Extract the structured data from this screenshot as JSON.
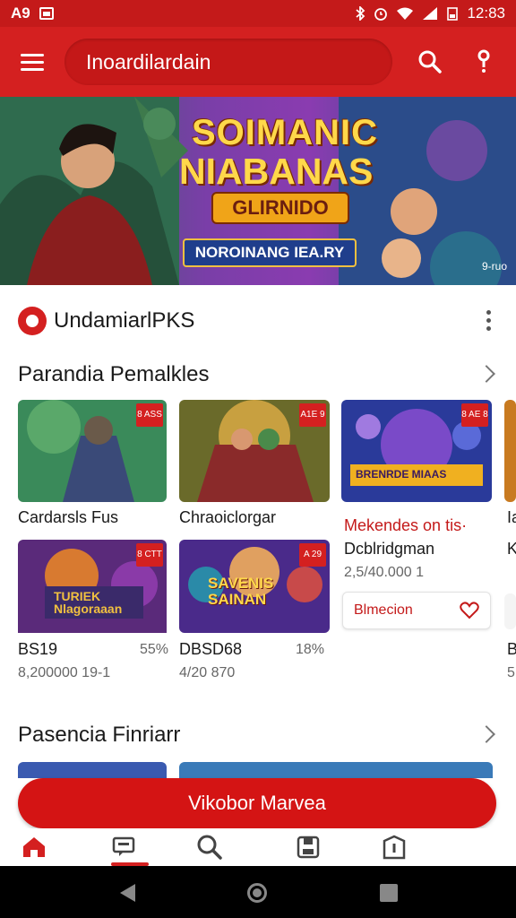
{
  "status": {
    "carrier": "A9",
    "time": "12:83"
  },
  "header": {
    "title": "Inoardilardain"
  },
  "banner": {
    "title_line1": "SOIMANIC",
    "title_line2": "NIABANAS",
    "title_line3": "GLIRNIDO",
    "subtitle": "NOROINANG IEA.RY",
    "corner": "9-ruo"
  },
  "brand": {
    "name": "UndamiarlPKS"
  },
  "sections": [
    {
      "title": "Parandia Pemalkles"
    },
    {
      "title": "Pasencia Finriarr"
    }
  ],
  "cards": [
    {
      "badge": "8 ASS",
      "title": "Cardarsls Fus"
    },
    {
      "badge": "A1E 9",
      "title": "Chraoiclorgar"
    },
    {
      "badge": "8 AE 8",
      "title": "BRENRDE MIAAS"
    },
    {
      "badge": "8 CTT",
      "price": "BS19",
      "discount": "55%",
      "sub": "8,200000 19-1",
      "label": "TURIEK Nlagoraaan"
    },
    {
      "badge": "A 29",
      "price": "DBSD68",
      "discount": "18%",
      "sub": "4/20 870",
      "label": "SAVENIS SAINAN"
    }
  ],
  "feature_card": {
    "title": "Mekendes on tis·",
    "subtitle": "Dcblridgman",
    "meta": "2,5/40.000 1",
    "action": "Blmecion"
  },
  "edge_card": {
    "title_a": "Ia",
    "title_b": "K",
    "price": "B",
    "sub": "5"
  },
  "cta": {
    "label": "Vikobor Marvea"
  },
  "nav": [
    "home",
    "chat",
    "search",
    "saved",
    "info"
  ]
}
